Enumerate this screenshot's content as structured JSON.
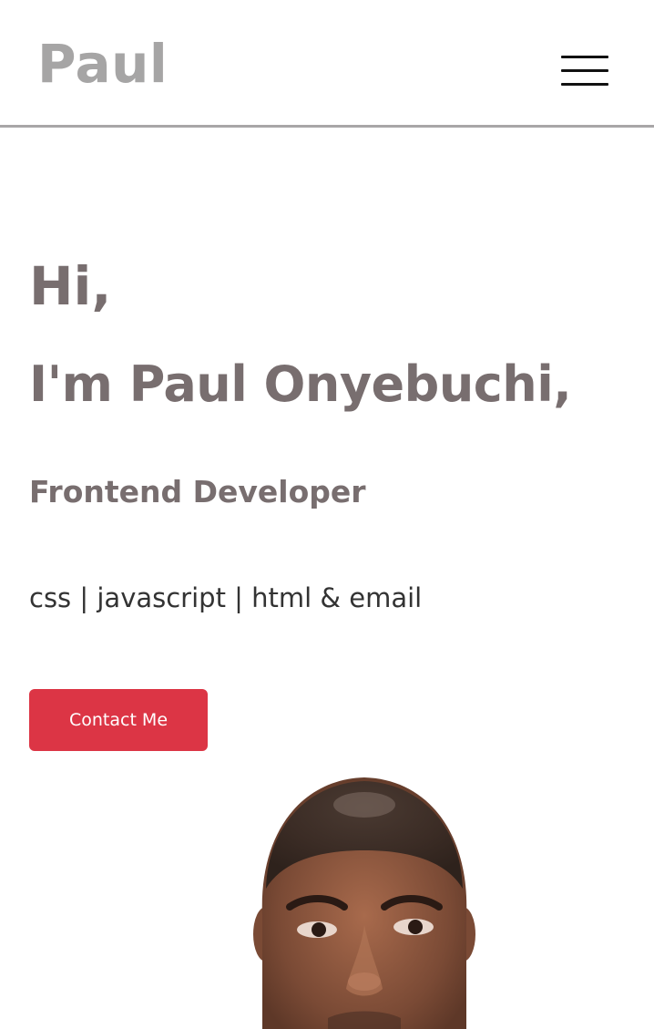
{
  "header": {
    "logo_text": "Paul",
    "menu_icon": "hamburger-menu-icon"
  },
  "hero": {
    "greeting": "Hi,",
    "name_line": "I'm Paul Onyebuchi,",
    "role": "Frontend Developer",
    "skills": "css | javascript | html & email",
    "contact_button_label": "Contact Me"
  },
  "colors": {
    "accent": "#dc3545",
    "heading": "#786e6f",
    "logo": "#a6a5a5",
    "divider": "#a8a6a7"
  }
}
